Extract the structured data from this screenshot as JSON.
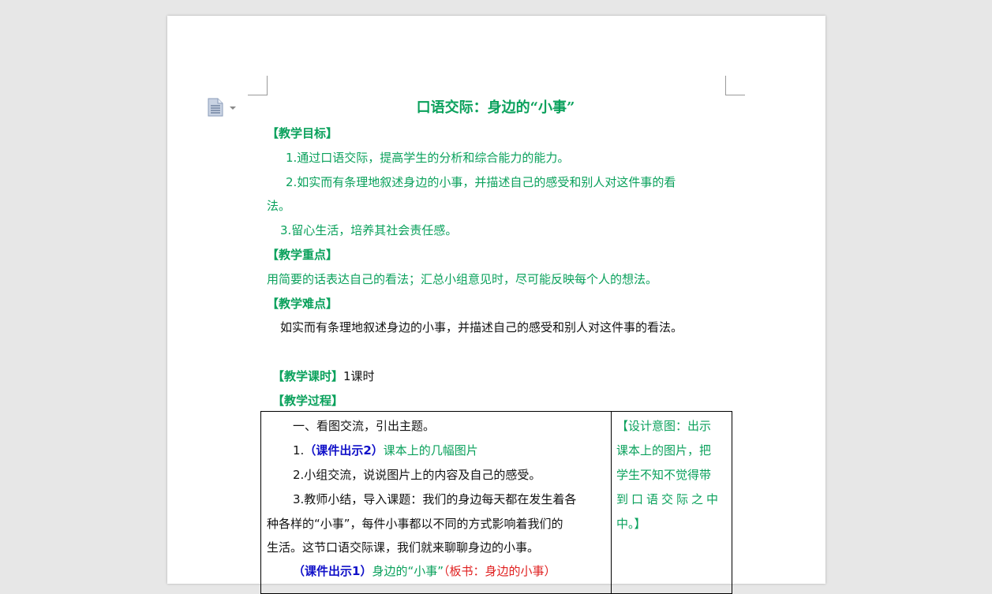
{
  "document": {
    "title": "口语交际：身边的“小事”",
    "goal_heading": "【教学目标】",
    "goal_1": "1.通过口语交际，提高学生的分析和综合能力的能力。",
    "goal_2a": "2.如实而有条理地叙述身边的小事，并描述自己的感受和别人对这件事的看",
    "goal_2b": "法。",
    "goal_3": "3.留心生活，培养其社会责任感。",
    "focus_heading": "【教学重点】",
    "focus_text": "用简要的话表达自己的看法；汇总小组意见时，尽可能反映每个人的想法。",
    "difficulty_heading": "【教学难点】",
    "difficulty_text": "如实而有条理地叙述身边的小事，并描述自己的感受和别人对这件事的看法。",
    "period_heading": "【教学课时】",
    "period_text": "1课时",
    "process_heading": "【教学过程】"
  },
  "table": {
    "row1": "一、看图交流，引出主题。",
    "row2_num": "1.",
    "row2_tag": "（课件出示2）",
    "row2_text": "课本上的几幅图片",
    "row3": "2.小组交流，说说图片上的内容及自己的感受。",
    "row4": "3.教师小结，导入课题：我们的身边每天都在发生着各",
    "row5": "种各样的“小事”，每件小事都以不同的方式影响着我们的",
    "row6": "生活。这节口语交际课，我们就来聊聊身边的小事。",
    "row7_tag": "（课件出示1）",
    "row7_green": "身边的“小事”",
    "row7_red": "（板书：身边的小事）",
    "side_1": "【设计意图：出示",
    "side_2": "课本上的图片，把",
    "side_3": "学生不知不觉得带",
    "side_4": "到口语交际之中",
    "side_5": "中。】"
  },
  "colors": {
    "heading_green": "#0aa15c",
    "tag_blue": "#1010c8",
    "note_red": "#e02020"
  }
}
